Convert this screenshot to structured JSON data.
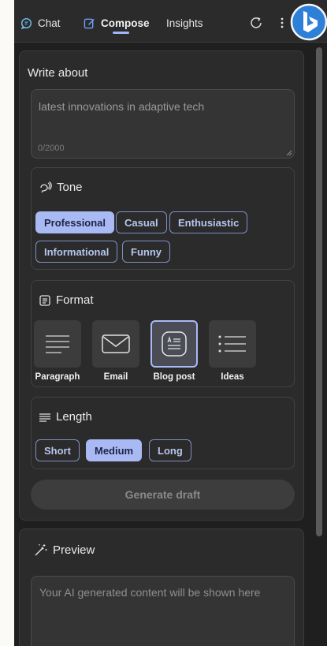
{
  "nav": {
    "tabs": [
      {
        "label": "Chat",
        "icon": "chat-icon"
      },
      {
        "label": "Compose",
        "icon": "compose-icon"
      },
      {
        "label": "Insights",
        "icon": ""
      }
    ],
    "active_tab": "Compose",
    "refresh_icon": "refresh-icon",
    "more_icon": "more-icon",
    "logo": "bing-logo"
  },
  "compose": {
    "write_label": "Write about",
    "input_value": "latest innovations in adaptive tech",
    "char_count": "0/2000",
    "tone": {
      "title": "Tone",
      "icon": "tone-icon",
      "options": [
        "Professional",
        "Casual",
        "Enthusiastic",
        "Informational",
        "Funny"
      ],
      "selected": "Professional"
    },
    "format": {
      "title": "Format",
      "icon": "format-icon",
      "options": [
        "Paragraph",
        "Email",
        "Blog post",
        "Ideas"
      ],
      "selected": "Blog post"
    },
    "length": {
      "title": "Length",
      "icon": "length-icon",
      "options": [
        "Short",
        "Medium",
        "Long"
      ],
      "selected": "Medium"
    },
    "generate_label": "Generate draft"
  },
  "preview": {
    "title": "Preview",
    "icon": "magic-wand-icon",
    "placeholder": "Your AI generated content will be shown here"
  },
  "colors": {
    "accent": "#a9b9f4",
    "panel_bg": "#1f1f1f",
    "card_bg": "#2b2b2b"
  }
}
